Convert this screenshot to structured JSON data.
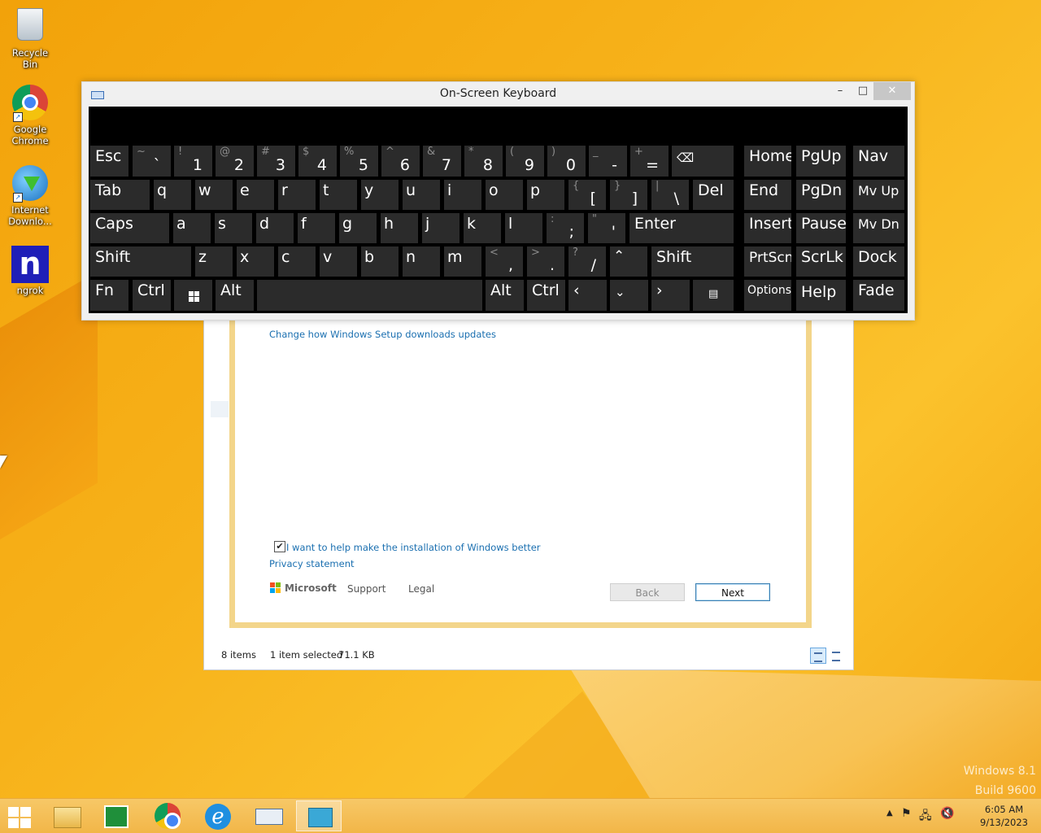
{
  "desktop": {
    "icons": [
      {
        "label": "Recycle Bin"
      },
      {
        "label": "Google Chrome"
      },
      {
        "label": "Internet Downlo..."
      },
      {
        "label": "ngrok"
      }
    ],
    "watermark": {
      "line1": "Windows 8.1",
      "line2": "Build 9600"
    }
  },
  "osk": {
    "title": "On-Screen Keyboard",
    "controls": {
      "minimize": "–",
      "maximize": "□",
      "close": "✕"
    }
  },
  "explorer": {
    "status_items": "8 items",
    "status_selected": "1 item selected",
    "status_size": "71.1 KB"
  },
  "setup": {
    "link_updates": "Change how Windows Setup downloads updates",
    "checkbox_mark": "✔",
    "checkbox_label": "I want to help make the installation of Windows better",
    "privacy_link": "Privacy statement",
    "microsoft_label": "Microsoft",
    "support_label": "Support",
    "legal_label": "Legal",
    "back_label": "Back",
    "next_label": "Next"
  },
  "taskbar": {
    "clock_time": "6:05 AM",
    "clock_date": "9/13/2023"
  },
  "colors": {
    "link": "#1a6fb0",
    "key_bg": "#2b2b2b",
    "desktop_accent": "#f5a814",
    "ngrok_blue": "#1f1fb8"
  }
}
